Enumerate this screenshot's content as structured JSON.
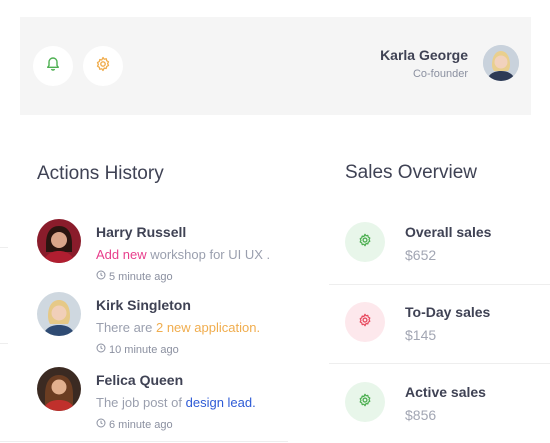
{
  "header": {
    "notifications_icon": "bell-icon",
    "settings_icon": "gear-icon",
    "user_name": "Karla George",
    "user_role": "Co-founder"
  },
  "actions_history": {
    "title": "Actions History",
    "items": [
      {
        "name": "Harry Russell",
        "message_prefix": "",
        "message_highlight": "Add new",
        "message_suffix": " workshop for UI UX .",
        "highlight_color": "#e83e8c",
        "time": "5 minute ago"
      },
      {
        "name": "Kirk Singleton",
        "message_prefix": "There are ",
        "message_highlight": "2 new application.",
        "message_suffix": "",
        "highlight_color": "#f0ad4e",
        "time": "10 minute ago"
      },
      {
        "name": "Felica Queen",
        "message_prefix": "The job post of ",
        "message_highlight": "design lead.",
        "message_suffix": "",
        "highlight_color": "#2e5bd6",
        "time": "6 minute ago"
      }
    ]
  },
  "sales_overview": {
    "title": "Sales Overview",
    "items": [
      {
        "label": "Overall sales",
        "amount": "$652",
        "icon": "gear-icon",
        "tone": "#4caf50",
        "bg": "#e8f6ea"
      },
      {
        "label": "To-Day sales",
        "amount": "$145",
        "icon": "gear-icon",
        "tone": "#e84a5f",
        "bg": "#fde8ec"
      },
      {
        "label": "Active sales",
        "amount": "$856",
        "icon": "gear-icon",
        "tone": "#4caf50",
        "bg": "#e8f6ea"
      }
    ]
  },
  "colors": {
    "bell": "#4caf50",
    "gear_header": "#f0ad4e"
  }
}
